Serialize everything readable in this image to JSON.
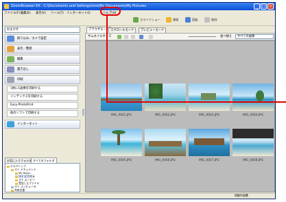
{
  "window": {
    "title": "ZoomBrowser EX - C:\\Documents and Settings\\hiro\\My Documents\\My Pictures",
    "controls": [
      "_",
      "□",
      "×"
    ]
  },
  "menu": [
    "ファイル(F)",
    "編集(E)",
    "表示(V)",
    "ツール(T)",
    "インターネット(I)",
    "ヘルプ(H)"
  ],
  "toolbar": {
    "items": [
      {
        "label": "スライドショー",
        "icon": "slideshow-icon"
      },
      {
        "label": "検索",
        "icon": "search-icon"
      },
      {
        "label": "回転",
        "icon": "rotate-icon"
      },
      {
        "label": "削除",
        "icon": "delete-icon"
      }
    ]
  },
  "left": {
    "address": "おまかせ",
    "nav": [
      {
        "label": "取り込み／カメラ設定",
        "icon": "camera-icon"
      },
      {
        "label": "表示／整理",
        "icon": "folder-icon"
      },
      {
        "label": "編集",
        "icon": "edit-icon"
      },
      {
        "label": "書き出し",
        "icon": "export-icon"
      },
      {
        "label": "印刷",
        "icon": "printer-icon"
      }
    ],
    "print_sub": [
      "1枚に1画像を印刷する",
      "インデックスを印刷する",
      "Easy-PhotoPrint",
      "他のソフトで印刷する"
    ],
    "internet": "インターネット",
    "tabs": [
      "お気に入りフォルダ",
      "すべてのフォルダ"
    ],
    "tree": [
      "デスクトップ",
      "マイ ドキュメント",
      "My Music",
      "マイ ピクチャ",
      "マイ ムービー",
      "受信したファイル",
      "マイ コンピュータ",
      "共有文書"
    ],
    "tree_button": "お気に入りに登録"
  },
  "right": {
    "tabs": [
      "ブラウザモード",
      "スクロールモード",
      "プレビューモード"
    ],
    "view_label": "サムネイルサイズ",
    "sort_label": "並べ替え",
    "filter": "すべての画像",
    "thumbnails": [
      {
        "caption": "IMG_0001.JPG"
      },
      {
        "caption": "IMG_0002.JPG"
      },
      {
        "caption": "IMG_0003.JPG"
      },
      {
        "caption": "IMG_0004.JPG"
      },
      {
        "caption": "IMG_0005.JPG"
      },
      {
        "caption": "IMG_0006.JPG"
      },
      {
        "caption": "IMG_0007.JPG"
      },
      {
        "caption": "IMG_0008.JPG"
      }
    ]
  },
  "status": {
    "text": "8個の画像"
  },
  "colors": {
    "accent": "#0a4fd8",
    "highlight": "#e00000",
    "thumb_bg": "#bbbbbb"
  }
}
